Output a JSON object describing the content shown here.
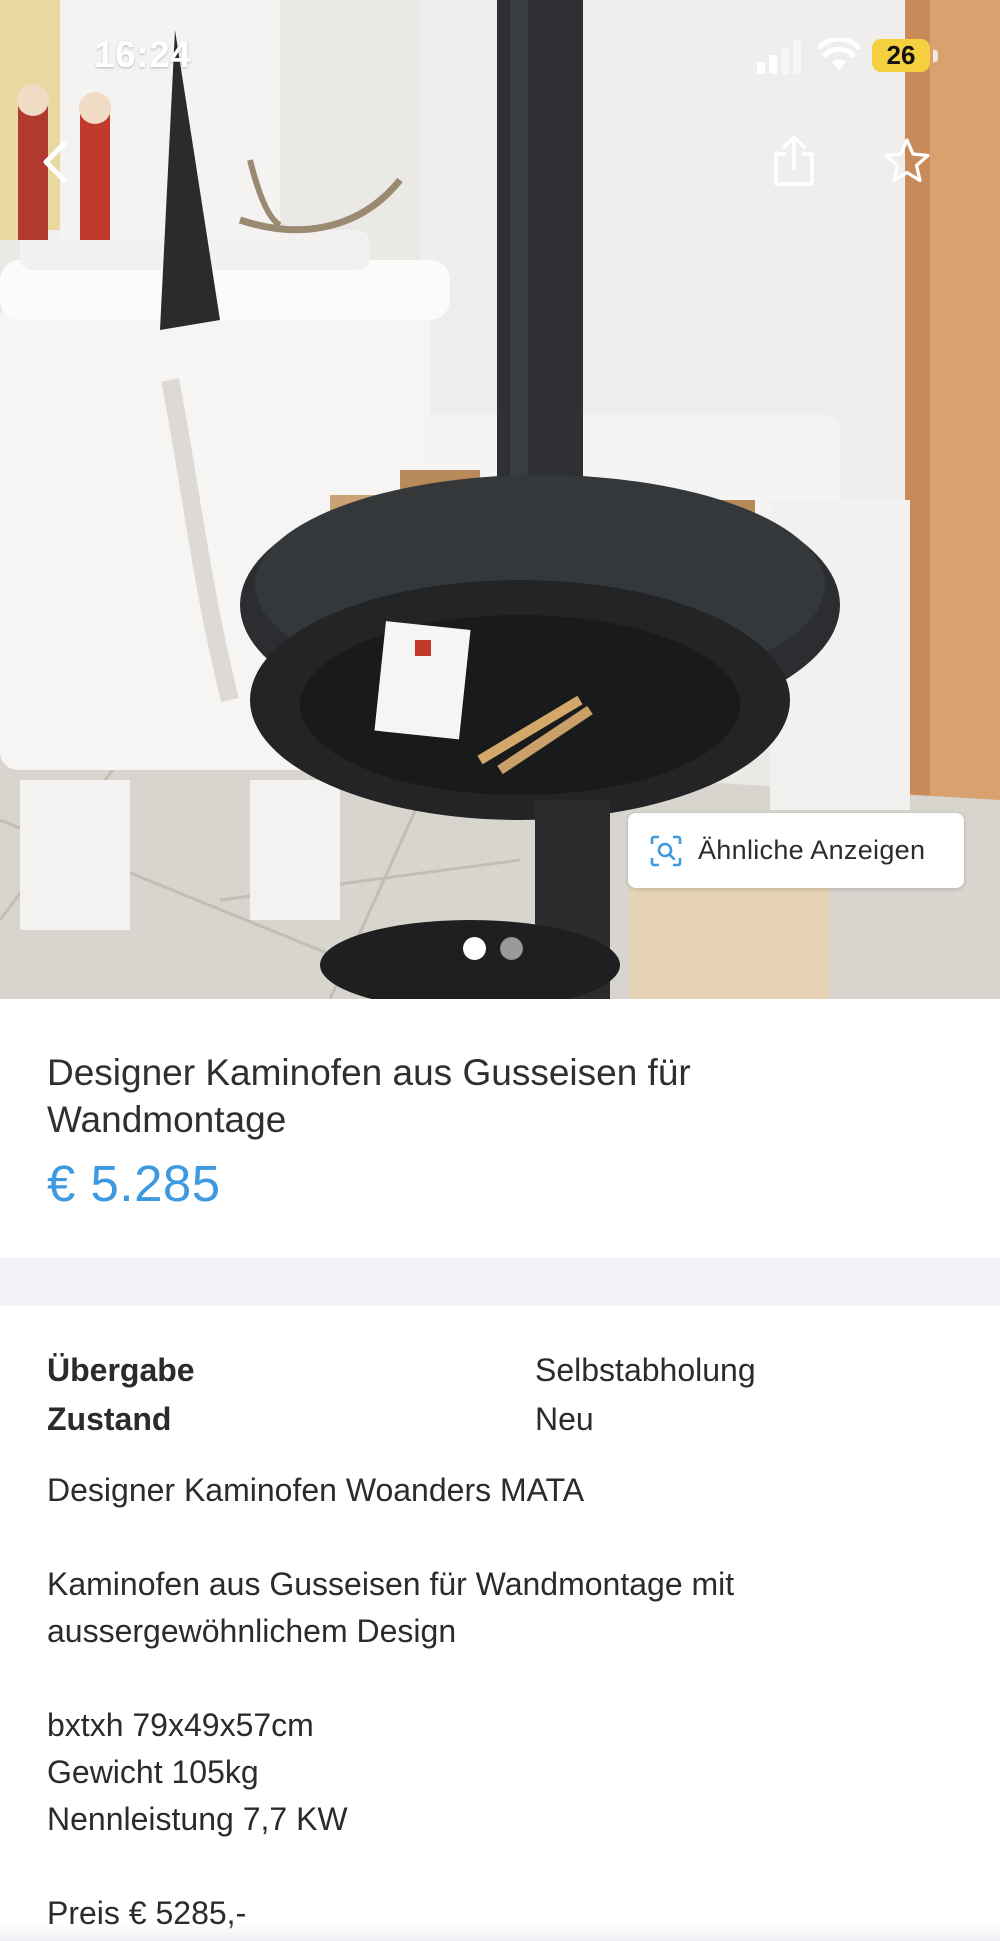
{
  "status_bar": {
    "time": "16:24",
    "battery_level": "26"
  },
  "photo": {
    "similar_ads_label": "Ähnliche Anzeigen",
    "pager": {
      "count": 2,
      "current": 1
    }
  },
  "listing": {
    "title": "Designer Kaminofen aus Gusseisen für Wandmontage",
    "price": "€ 5.285"
  },
  "attributes": [
    {
      "label": "Übergabe",
      "value": "Selbstabholung"
    },
    {
      "label": "Zustand",
      "value": "Neu"
    }
  ],
  "description": {
    "line1": "Designer Kaminofen Woanders MATA",
    "line2": "Kaminofen aus Gusseisen für Wandmontage mit",
    "line3": "aussergewöhnlichem Design",
    "line4": "bxtxh 79x49x57cm",
    "line5": "Gewicht 105kg",
    "line6": "Nennleistung 7,7 KW",
    "line7": "Preis € 5285,-"
  },
  "colors": {
    "price": "#3d9ae0",
    "battery": "#f4d03f",
    "divider": "#f1f2f6"
  },
  "icons": [
    "back-chevron-icon",
    "share-icon",
    "star-icon",
    "visual-search-icon",
    "signal-icon",
    "wifi-icon",
    "battery-icon"
  ]
}
